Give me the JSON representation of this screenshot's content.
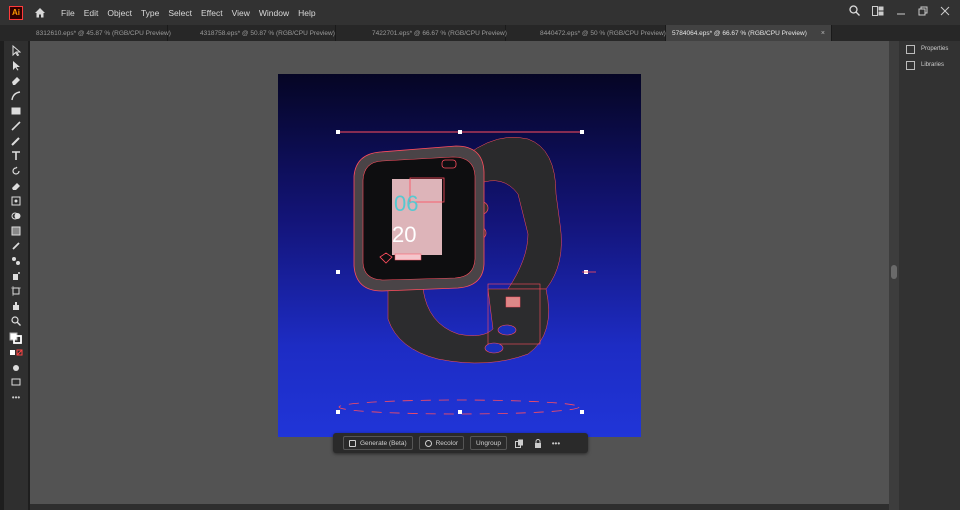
{
  "app": {
    "logo_text": "Ai"
  },
  "menu": [
    "File",
    "Edit",
    "Object",
    "Type",
    "Select",
    "Effect",
    "View",
    "Window",
    "Help"
  ],
  "tabs": [
    {
      "label": "8312610.eps* @ 45.87 % (RGB/CPU Preview)",
      "active": false
    },
    {
      "label": "4318758.eps* @ 50.87 % (RGB/CPU Preview)",
      "active": false
    },
    {
      "label": "7422701.eps* @ 66.67 % (RGB/CPU Preview)",
      "active": false
    },
    {
      "label": "8440472.eps* @ 50 % (RGB/CPU Preview)",
      "active": false
    },
    {
      "label": "5784064.eps* @ 66.67 % (RGB/CPU Preview)",
      "active": true,
      "close": "×"
    }
  ],
  "right_panel": {
    "items": [
      "Properties",
      "Libraries"
    ]
  },
  "watch_display": {
    "hour": "06",
    "minute": "20"
  },
  "context_bar": {
    "generate": "Generate (Beta)",
    "recolor": "Recolor",
    "ungroup": "Ungroup",
    "more": "•••"
  },
  "toolbar_more": "•••",
  "colors": {
    "accent_selection": "#ff4d5e",
    "bg_top": "#050524",
    "bg_bottom": "#2035d8"
  }
}
